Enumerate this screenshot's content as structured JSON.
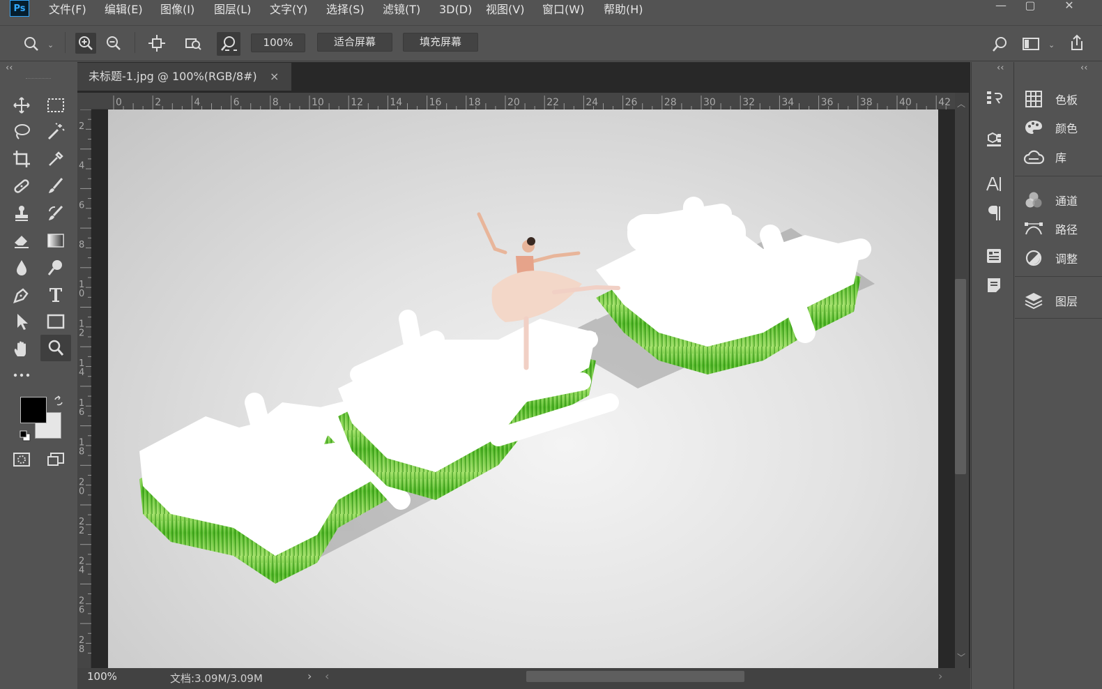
{
  "app": {
    "logo": "Ps"
  },
  "menu": [
    "文件(F)",
    "编辑(E)",
    "图像(I)",
    "图层(L)",
    "文字(Y)",
    "选择(S)",
    "滤镜(T)",
    "3D(D)",
    "视图(V)",
    "窗口(W)",
    "帮助(H)"
  ],
  "window_controls": {
    "minimize": "—",
    "maximize": "▢",
    "close": "✕"
  },
  "options": {
    "zoom_value": "100%",
    "fit_screen": "适合屏幕",
    "fill_screen": "填充屏幕"
  },
  "collapse": {
    "left": "‹‹",
    "mid": "‹‹",
    "right": "‹‹"
  },
  "document": {
    "tab_title": "未标题-1.jpg @ 100%(RGB/8#)",
    "tab_close": "×"
  },
  "ruler": {
    "h_labels": [
      "0",
      "2",
      "4",
      "6",
      "8",
      "10",
      "12",
      "14",
      "16",
      "18",
      "20",
      "22",
      "24",
      "26",
      "28",
      "30",
      "32",
      "34",
      "36",
      "38",
      "40",
      "42"
    ],
    "v_labels": [
      "2",
      "4",
      "6",
      "8",
      "10",
      "12",
      "14",
      "16",
      "18",
      "20",
      "22",
      "24",
      "26",
      "28"
    ]
  },
  "status": {
    "zoom": "100%",
    "doc_size": "文档:3.09M/3.09M",
    "arrow": "›",
    "scroll_left": "‹",
    "scroll_right": "›"
  },
  "panels": [
    {
      "icon": "swatches-icon",
      "label": "色板"
    },
    {
      "icon": "color-palette-icon",
      "label": "颜色"
    },
    {
      "icon": "libraries-icon",
      "label": "库"
    },
    {
      "icon": "channels-icon",
      "label": "通道"
    },
    {
      "icon": "paths-icon",
      "label": "路径"
    },
    {
      "icon": "adjustments-icon",
      "label": "调整"
    },
    {
      "icon": "layers-icon",
      "label": "图层"
    }
  ],
  "colors": {
    "foreground": "#000000",
    "background": "#e6e6e6",
    "accent": "#31a8ff"
  }
}
